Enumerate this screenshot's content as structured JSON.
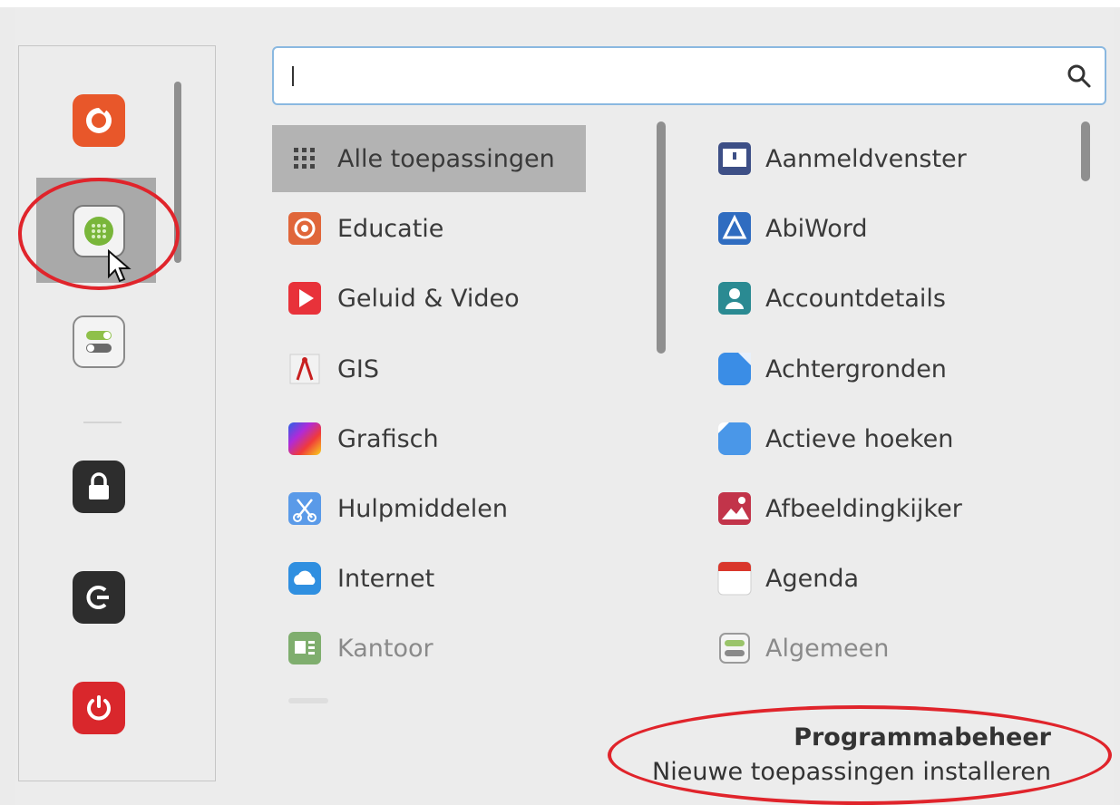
{
  "search": {
    "value": "",
    "placeholder": ""
  },
  "sidebar": {
    "items": [
      {
        "name": "favorite-app",
        "icon": "orange-circle-arrow-icon"
      },
      {
        "name": "software-manager",
        "icon": "green-grid-icon"
      },
      {
        "name": "system-settings",
        "icon": "toggle-switches-icon"
      },
      {
        "name": "lock-screen",
        "icon": "lock-icon"
      },
      {
        "name": "logout",
        "icon": "logout-icon"
      },
      {
        "name": "shutdown",
        "icon": "power-icon"
      }
    ]
  },
  "categories": [
    {
      "label": "Alle toepassingen",
      "icon": "grid-dots-icon"
    },
    {
      "label": "Educatie",
      "icon": "education-icon"
    },
    {
      "label": "Geluid & Video",
      "icon": "play-icon"
    },
    {
      "label": "GIS",
      "icon": "compass-icon"
    },
    {
      "label": "Grafisch",
      "icon": "gradient-icon"
    },
    {
      "label": "Hulpmiddelen",
      "icon": "scissors-icon"
    },
    {
      "label": "Internet",
      "icon": "cloud-icon"
    },
    {
      "label": "Kantoor",
      "icon": "office-icon"
    }
  ],
  "apps": [
    {
      "label": "Aanmeldvenster",
      "icon": "login-window-icon"
    },
    {
      "label": "AbiWord",
      "icon": "abiword-icon"
    },
    {
      "label": "Accountdetails",
      "icon": "account-icon"
    },
    {
      "label": "Achtergronden",
      "icon": "backgrounds-icon"
    },
    {
      "label": "Actieve hoeken",
      "icon": "hot-corners-icon"
    },
    {
      "label": "Afbeeldingkijker",
      "icon": "image-viewer-icon"
    },
    {
      "label": "Agenda",
      "icon": "calendar-icon"
    },
    {
      "label": "Algemeen",
      "icon": "general-settings-icon"
    }
  ],
  "description": {
    "title": "Programmabeheer",
    "text": "Nieuwe toepassingen installeren"
  },
  "colors": {
    "annotation": "#e0242b",
    "selection": "#b3b3b3",
    "search_border": "#8ab8e0"
  }
}
